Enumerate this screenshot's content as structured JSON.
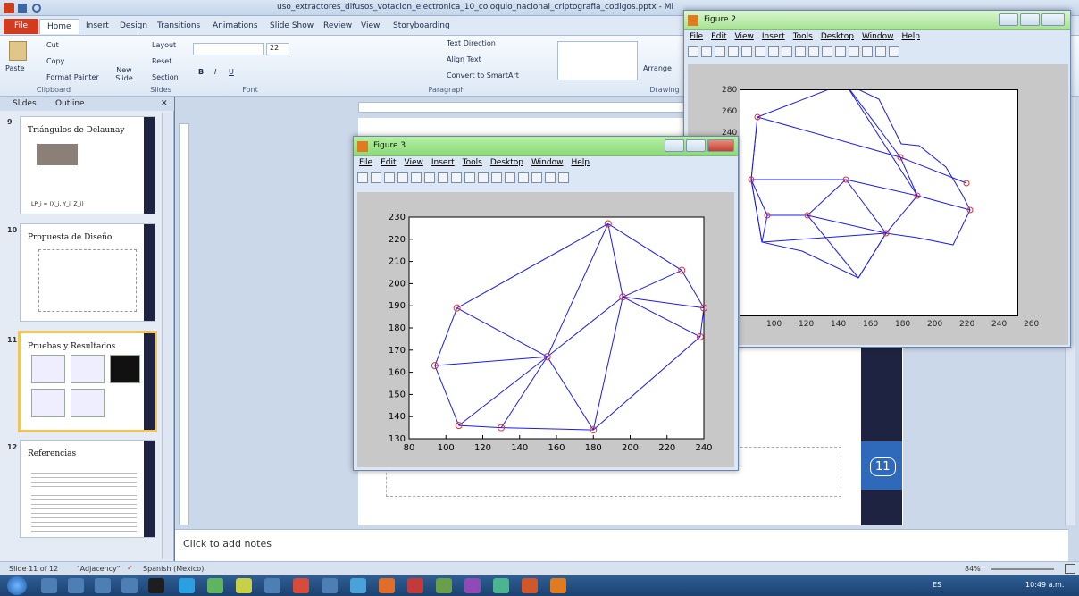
{
  "app": {
    "title": "uso_extractores_difusos_votacion_electronica_10_coloquio_nacional_criptografia_codigos.pptx - Mi",
    "tabs": [
      "File",
      "Home",
      "Insert",
      "Design",
      "Transitions",
      "Animations",
      "Slide Show",
      "Review",
      "View",
      "Storyboarding"
    ],
    "ribbon": {
      "clipboard": {
        "paste": "Paste",
        "cut": "Cut",
        "copy": "Copy",
        "format_painter": "Format Painter",
        "label": "Clipboard"
      },
      "slides": {
        "new_slide": "New Slide",
        "layout": "Layout",
        "reset": "Reset",
        "section": "Section",
        "label": "Slides"
      },
      "font": {
        "size": "22",
        "label": "Font"
      },
      "paragraph": {
        "text_direction": "Text Direction",
        "align_text": "Align Text",
        "convert": "Convert to SmartArt",
        "label": "Paragraph"
      },
      "drawing": {
        "arrange": "Arrange",
        "label": "Drawing"
      }
    }
  },
  "left_pane": {
    "tabs": [
      "Slides",
      "Outline"
    ],
    "slides": [
      {
        "num": "9",
        "title": "Triángulos de Delaunay",
        "thumb_caption": "LP_i = (X_i, Y_i, Z_i)"
      },
      {
        "num": "10",
        "title": "Propuesta de Diseño"
      },
      {
        "num": "11",
        "title": "Pruebas y Resultados"
      },
      {
        "num": "12",
        "title": "Referencias"
      }
    ]
  },
  "editor": {
    "notes_placeholder": "Click to add notes",
    "slide_number": "11"
  },
  "status": {
    "slide": "Slide 11 of 12",
    "theme": "\"Adjacency\"",
    "language": "Spanish (Mexico)",
    "zoom": "84%"
  },
  "taskbar": {
    "lang": "ES",
    "time": "10:49 a.m."
  },
  "figure2": {
    "title": "Figure 2",
    "menu": [
      "File",
      "Edit",
      "View",
      "Insert",
      "Tools",
      "Desktop",
      "Window",
      "Help"
    ],
    "yticks": [
      "280",
      "260",
      "240"
    ],
    "xticks": [
      "100",
      "120",
      "140",
      "160",
      "180",
      "200",
      "220",
      "240",
      "260"
    ]
  },
  "figure3": {
    "title": "Figure 3",
    "menu": [
      "File",
      "Edit",
      "View",
      "Insert",
      "Tools",
      "Desktop",
      "Window",
      "Help"
    ]
  },
  "chart_data": {
    "type": "scatter",
    "title": "",
    "xlim": [
      80,
      240
    ],
    "ylim": [
      130,
      230
    ],
    "xticks": [
      80,
      100,
      120,
      140,
      160,
      180,
      200,
      220,
      240
    ],
    "yticks": [
      130,
      140,
      150,
      160,
      170,
      180,
      190,
      200,
      210,
      220,
      230
    ],
    "points": [
      [
        106,
        189
      ],
      [
        94,
        163
      ],
      [
        107,
        136
      ],
      [
        130,
        135
      ],
      [
        155,
        167
      ],
      [
        180,
        134
      ],
      [
        188,
        227
      ],
      [
        196,
        194
      ],
      [
        228,
        206
      ],
      [
        240,
        189
      ],
      [
        238,
        176
      ]
    ],
    "edges": [
      [
        0,
        6
      ],
      [
        0,
        1
      ],
      [
        0,
        4
      ],
      [
        1,
        2
      ],
      [
        1,
        4
      ],
      [
        2,
        3
      ],
      [
        2,
        4
      ],
      [
        3,
        4
      ],
      [
        3,
        5
      ],
      [
        4,
        5
      ],
      [
        4,
        6
      ],
      [
        4,
        7
      ],
      [
        6,
        7
      ],
      [
        6,
        8
      ],
      [
        7,
        8
      ],
      [
        7,
        9
      ],
      [
        8,
        9
      ],
      [
        7,
        10
      ],
      [
        9,
        10
      ],
      [
        5,
        7
      ],
      [
        5,
        10
      ]
    ],
    "colors": {
      "edges": "#1a1aee",
      "points": "#e03030"
    }
  }
}
